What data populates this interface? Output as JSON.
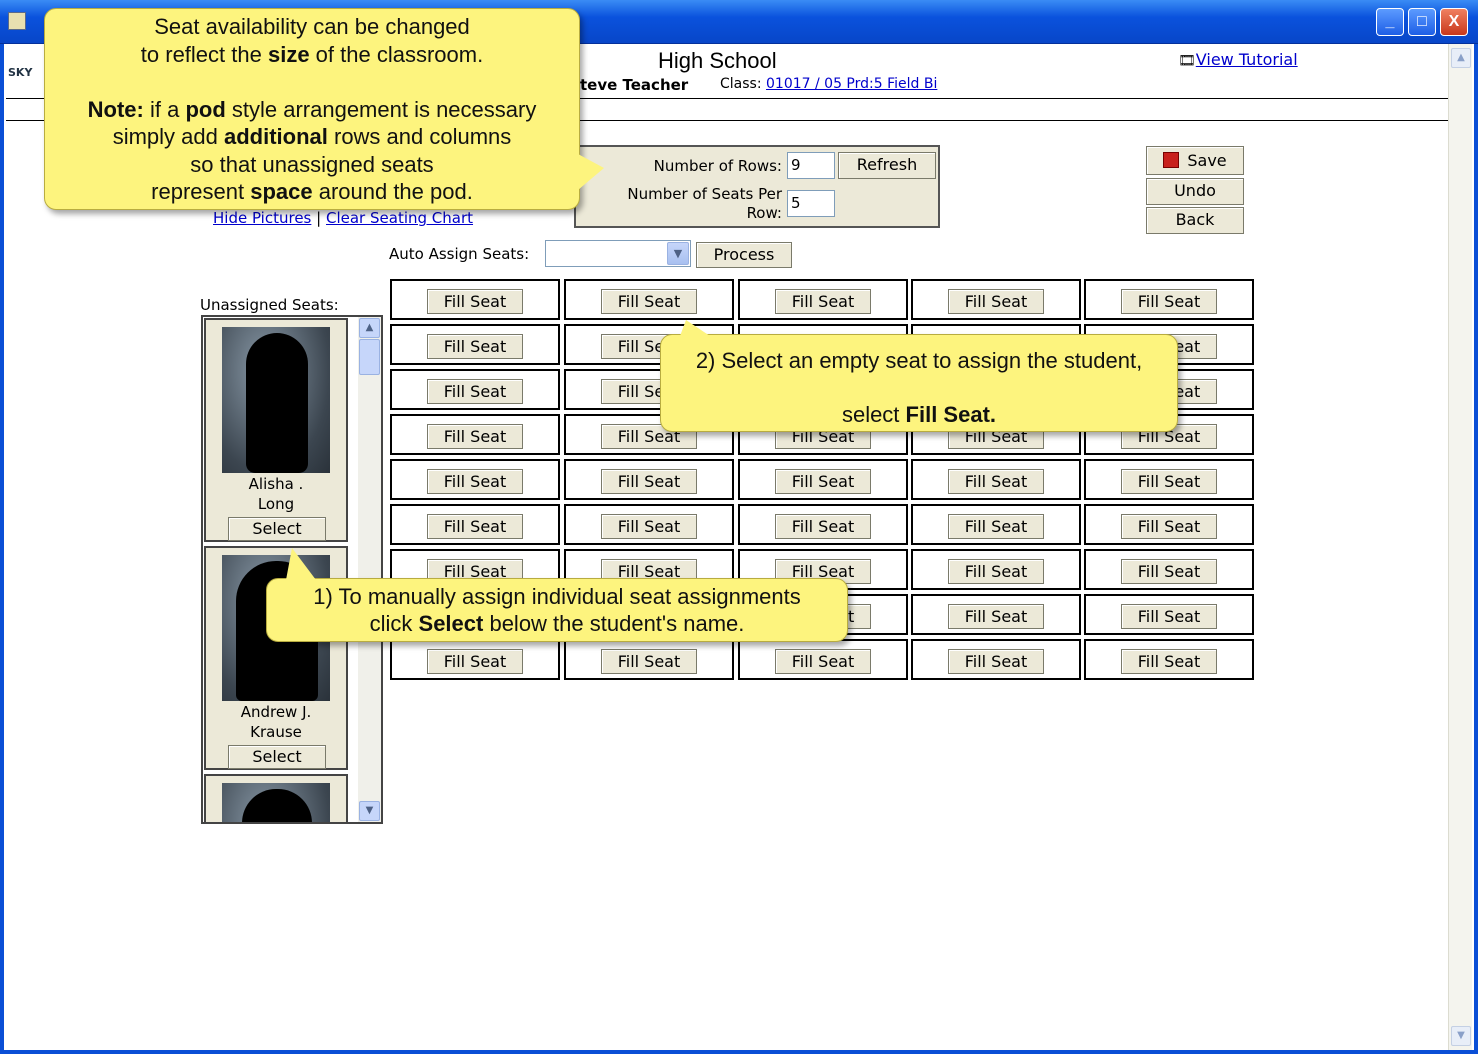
{
  "window": {
    "minimize": "_",
    "maximize": "□",
    "close": "X"
  },
  "header": {
    "school": "High School",
    "teacher": "teve Teacher",
    "class_label": "Class:",
    "class_link": "01017 / 05 Prd:5 Field Bi",
    "tutorial": "View Tutorial",
    "logo": "SKY"
  },
  "links": {
    "hide_pictures": "Hide Pictures",
    "separator": "|",
    "clear_chart": "Clear Seating Chart"
  },
  "panel": {
    "rows_label": "Number of Rows:",
    "rows_value": "9",
    "seats_label_1": "Number of Seats Per",
    "seats_label_2": "Row:",
    "seats_value": "5",
    "refresh": "Refresh"
  },
  "actions": {
    "save": "Save",
    "undo": "Undo",
    "back": "Back"
  },
  "auto": {
    "label": "Auto Assign Seats:",
    "value": "",
    "process": "Process"
  },
  "seat_button": "Fill Seat",
  "unassigned": {
    "label": "Unassigned Seats:",
    "students": [
      {
        "first": "Alisha .",
        "last": "Long",
        "select": "Select"
      },
      {
        "first": "Andrew J.",
        "last": "Krause",
        "select": "Select"
      }
    ]
  },
  "callouts": {
    "c1_l1": "Seat availability can be changed",
    "c1_l2a": "to reflect the ",
    "c1_l2b": "size",
    "c1_l2c": " of the classroom.",
    "c1_l3a": "Note:",
    "c1_l3b": " if a ",
    "c1_l3c": "pod",
    "c1_l3d": " style arrangement is necessary",
    "c1_l4a": "simply add ",
    "c1_l4b": "additional",
    "c1_l4c": " rows and columns",
    "c1_l5": "so that unassigned seats",
    "c1_l6a": "represent ",
    "c1_l6b": "space",
    "c1_l6c": " around the pod.",
    "c2_l1": "2) Select an empty seat to assign the student,",
    "c2_l2a": "select ",
    "c2_l2b": "Fill Seat.",
    "c3_l1": "1) To manually assign individual seat assignments",
    "c3_l2a": "click ",
    "c3_l2b": "Select",
    "c3_l2c": " below the student's name."
  }
}
